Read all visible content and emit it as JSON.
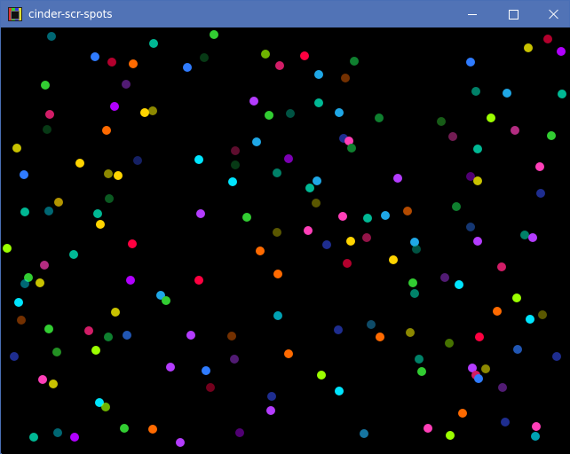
{
  "window": {
    "title": "cinder-scr-spots",
    "icons": {
      "app": "app-icon",
      "minimize": "minimize-icon",
      "maximize": "maximize-icon",
      "close": "close-icon"
    }
  },
  "canvas": {
    "background": "#000000",
    "spot_palette": [
      "#ff0040",
      "#00e5ff",
      "#32cd32",
      "#ff3fb8",
      "#ffd400",
      "#2f7bff",
      "#ff6a00",
      "#b100ff",
      "#00b894",
      "#d11d67",
      "#9cff00",
      "#1e2d8f",
      "#c8c200",
      "#0f7f2f",
      "#b43cff",
      "#1fa7e6"
    ]
  }
}
